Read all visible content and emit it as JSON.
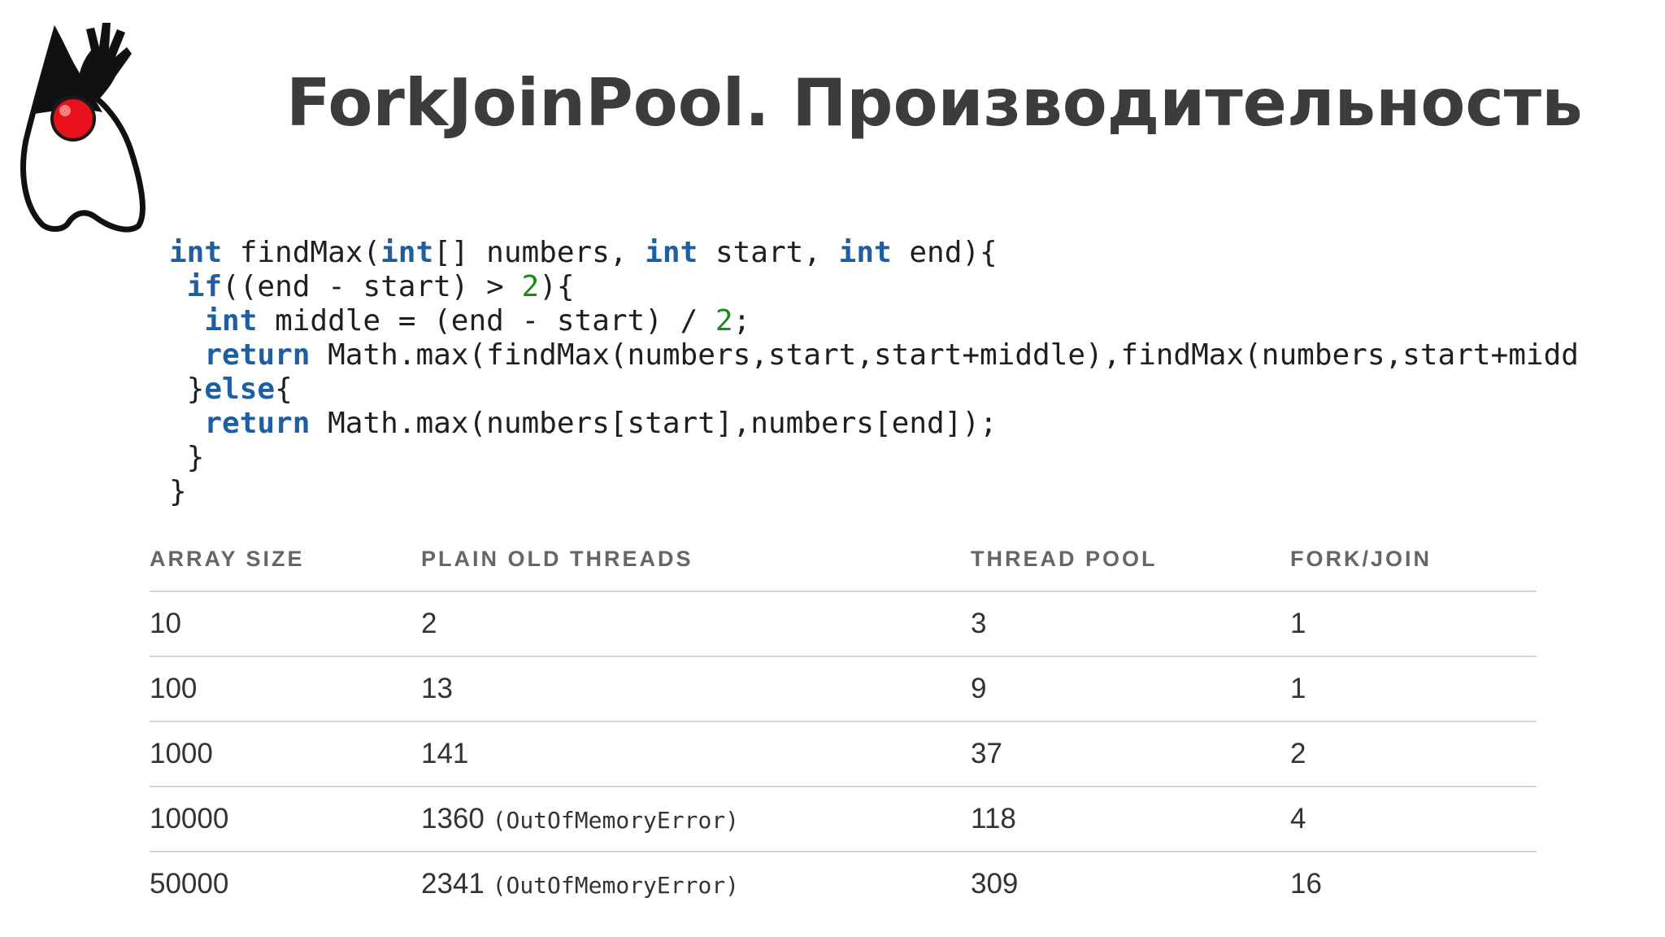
{
  "slide": {
    "title": "ForkJoinPool. Производительность",
    "logo_icon": "java-duke-mascot"
  },
  "code": {
    "lines": [
      [
        {
          "t": "int",
          "k": "kw"
        },
        {
          "t": " findMax("
        },
        {
          "t": "int",
          "k": "kw"
        },
        {
          "t": "[] numbers, "
        },
        {
          "t": "int",
          "k": "kw"
        },
        {
          "t": " start, "
        },
        {
          "t": "int",
          "k": "kw"
        },
        {
          "t": " end){"
        }
      ],
      [
        {
          "t": " "
        },
        {
          "t": "if",
          "k": "kw"
        },
        {
          "t": "((end - start) > "
        },
        {
          "t": "2",
          "k": "num"
        },
        {
          "t": "){"
        }
      ],
      [
        {
          "t": "  "
        },
        {
          "t": "int",
          "k": "kw"
        },
        {
          "t": " middle = (end - start) / "
        },
        {
          "t": "2",
          "k": "num"
        },
        {
          "t": ";"
        }
      ],
      [
        {
          "t": "  "
        },
        {
          "t": "return",
          "k": "kw"
        },
        {
          "t": " Math.max(findMax(numbers,start,start+middle),findMax(numbers,start+midd"
        }
      ],
      [
        {
          "t": " }"
        },
        {
          "t": "else",
          "k": "kw"
        },
        {
          "t": "{"
        }
      ],
      [
        {
          "t": "  "
        },
        {
          "t": "return",
          "k": "kw"
        },
        {
          "t": " Math.max(numbers[start],numbers[end]);"
        }
      ],
      [
        {
          "t": " }"
        }
      ],
      [
        {
          "t": "}"
        }
      ]
    ]
  },
  "table": {
    "headers": [
      "ARRAY SIZE",
      "PLAIN OLD THREADS",
      "THREAD POOL",
      "FORK/JOIN"
    ],
    "rows": [
      {
        "size": "10",
        "plain": "2",
        "plain_note": "",
        "pool": "3",
        "forkjoin": "1"
      },
      {
        "size": "100",
        "plain": "13",
        "plain_note": "",
        "pool": "9",
        "forkjoin": "1"
      },
      {
        "size": "1000",
        "plain": "141",
        "plain_note": "",
        "pool": "37",
        "forkjoin": "2"
      },
      {
        "size": "10000",
        "plain": "1360",
        "plain_note": "(OutOfMemoryError)",
        "pool": "118",
        "forkjoin": "4"
      },
      {
        "size": "50000",
        "plain": "2341",
        "plain_note": "(OutOfMemoryError)",
        "pool": "309",
        "forkjoin": "16"
      }
    ]
  },
  "colors": {
    "title": "#3c3c3c",
    "keyword": "#1e5fa3",
    "number": "#1a8a1a",
    "table_text": "#333333",
    "table_header": "#666666",
    "rule": "#d6d6d6"
  }
}
